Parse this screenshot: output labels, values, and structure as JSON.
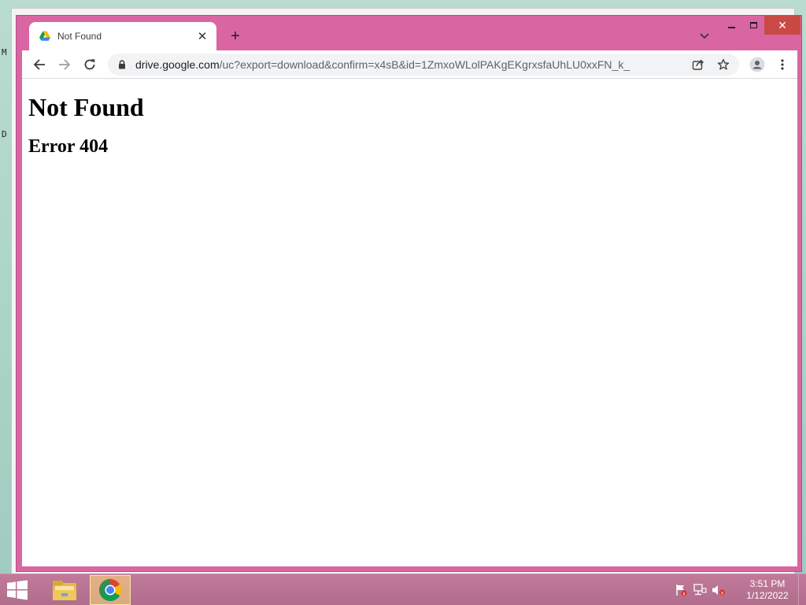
{
  "browser": {
    "tab": {
      "title": "Not Found",
      "favicon": "google-drive-icon"
    },
    "address_bar": {
      "host": "drive.google.com",
      "path": "/uc?export=download&confirm=x4sB&id=1ZmxoWLolPAKgEKgrxsfaUhLU0xxFN_k_"
    }
  },
  "page": {
    "heading": "Not Found",
    "subheading": "Error 404"
  },
  "taskbar": {
    "items": [
      "file-explorer-icon",
      "chrome-icon"
    ],
    "clock": {
      "time": "3:51 PM",
      "date": "1/12/2022"
    }
  },
  "colors": {
    "window_frame": "#d966a3",
    "taskbar": "#b06d8c",
    "close_button": "#c94a45"
  }
}
